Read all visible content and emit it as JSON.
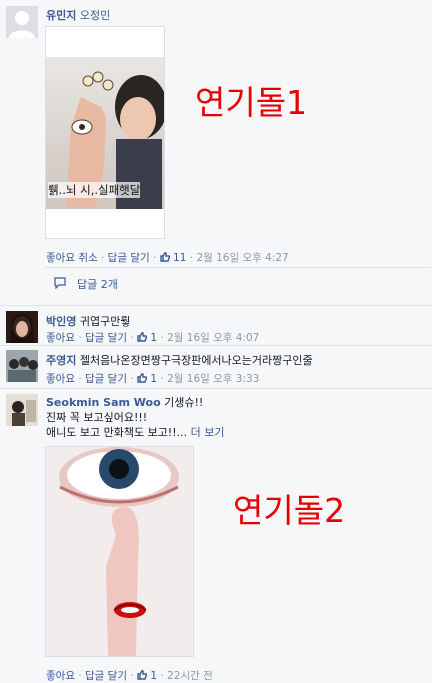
{
  "comment1": {
    "author": "유민지",
    "tagged": "오정민",
    "photo_caption": "뤩..뇌 시,.실패햇달",
    "overlay_label": "연기돌1",
    "actions": {
      "like": "좋아요 취소",
      "reply": "답글 달기",
      "likes_count": "11",
      "time": "2월 16일 오후 4:27"
    },
    "replies_label": "답글 2개"
  },
  "comment2": {
    "author": "박인영",
    "text": "귀엽구만뤟",
    "actions": {
      "like": "좋아요",
      "reply": "답글 달기",
      "likes_count": "1",
      "time": "2월 16일 오후 4:07"
    }
  },
  "comment3": {
    "author": "주영지",
    "text": "젤처음나온장면짱구극장판에서나오는거라짱구인줄",
    "actions": {
      "like": "좋아요",
      "reply": "답글 달기",
      "likes_count": "1",
      "time": "2월 16일 오후 3:33"
    }
  },
  "comment4": {
    "author": "Seokmin Sam Woo",
    "line1": "기생슈!!",
    "line2": "진짜 꼭 보고싶어요!!!",
    "line3": "애니도 보고 만화책도 보고!!...",
    "more": "더 보기",
    "overlay_label": "연기돌2",
    "actions": {
      "like": "좋아요",
      "reply": "답글 달기",
      "likes_count": "1",
      "time": "22시간 전"
    }
  },
  "icons": {
    "thumb": "thumbs-up-icon",
    "reply": "reply-arrow-icon",
    "avatar": "default-avatar-icon"
  },
  "colors": {
    "link": "#3b5998",
    "meta": "#9197a3",
    "overlay": "#e60000"
  }
}
